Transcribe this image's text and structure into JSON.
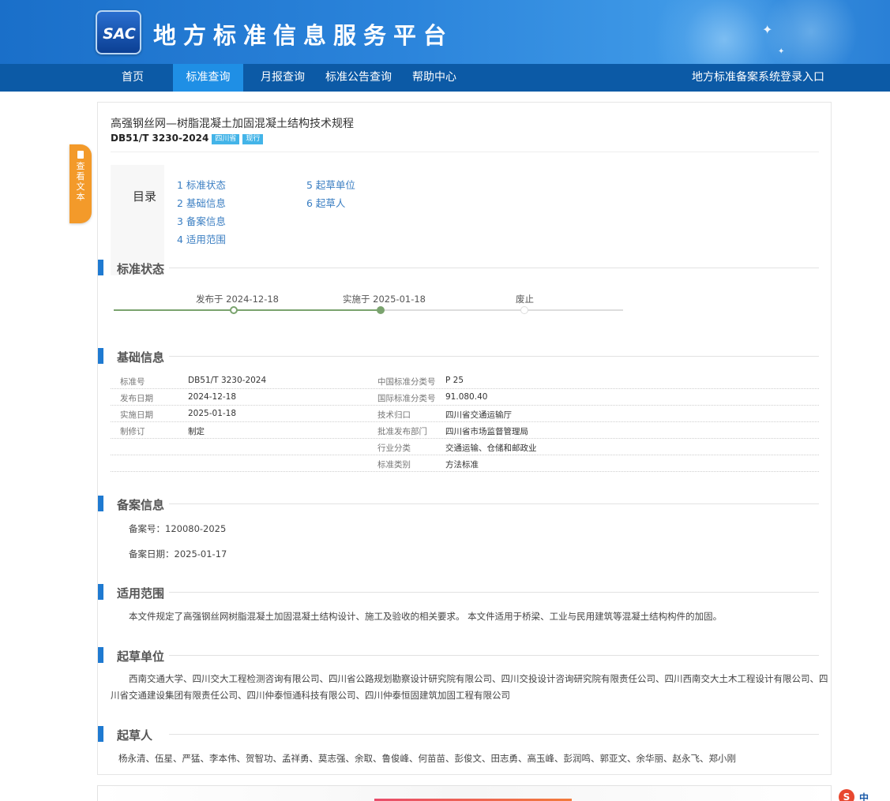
{
  "header": {
    "logo_text": "SAC",
    "site_title": "地方标准信息服务平台"
  },
  "nav": {
    "items": [
      {
        "label": "首页",
        "active": false
      },
      {
        "label": "标准查询",
        "active": true
      },
      {
        "label": "月报查询",
        "active": false
      },
      {
        "label": "标准公告查询",
        "active": false
      },
      {
        "label": "帮助中心",
        "active": false
      }
    ],
    "login_entry": "地方标准备案系统登录入口"
  },
  "side_tab": {
    "label": "查看文本",
    "icon": "document-icon"
  },
  "standard": {
    "title": "高强钢丝网—树脂混凝土加固混凝土结构技术规程",
    "code": "DB51/T 3230-2024",
    "badges": [
      "四川省",
      "现行"
    ]
  },
  "toc": {
    "label": "目录",
    "items": [
      "1 标准状态",
      "2 基础信息",
      "3 备案信息",
      "4 适用范围",
      "5 起草单位",
      "6 起草人"
    ]
  },
  "sections": {
    "status": "标准状态",
    "basic": "基础信息",
    "filing": "备案信息",
    "scope": "适用范围",
    "drafting_units": "起草单位",
    "drafters": "起草人"
  },
  "timeline": {
    "published": "发布于 2024-12-18",
    "implemented": "实施于 2025-01-18",
    "abolished": "废止",
    "colors": {
      "done": "#7aa36e",
      "pending": "#dddddd"
    }
  },
  "basic_info": {
    "left": [
      {
        "key": "标准号",
        "value": "DB51/T 3230-2024"
      },
      {
        "key": "发布日期",
        "value": "2024-12-18"
      },
      {
        "key": "实施日期",
        "value": "2025-01-18"
      },
      {
        "key": "制修订",
        "value": "制定"
      }
    ],
    "right": [
      {
        "key": "中国标准分类号",
        "value": "P 25"
      },
      {
        "key": "国际标准分类号",
        "value": "91.080.40"
      },
      {
        "key": "技术归口",
        "value": "四川省交通运输厅"
      },
      {
        "key": "批准发布部门",
        "value": "四川省市场监督管理局"
      },
      {
        "key": "行业分类",
        "value": "交通运输、仓储和邮政业"
      },
      {
        "key": "标准类别",
        "value": "方法标准"
      }
    ]
  },
  "filing": {
    "number": "备案号：120080-2025",
    "date": "备案日期：2025-01-17"
  },
  "scope_text": "本文件规定了高强钢丝网树脂混凝土加固混凝土结构设计、施工及验收的相关要求。 本文件适用于桥梁、工业与民用建筑等混凝土结构构件的加固。",
  "drafting_units_text": "西南交通大学、四川交大工程检测咨询有限公司、四川省公路规划勘察设计研究院有限公司、四川交投设计咨询研究院有限责任公司、四川西南交大土木工程设计有限公司、四川省交通建设集团有限责任公司、四川仲泰恒通科技有限公司、四川仲泰恒固建筑加固工程有限公司",
  "drafters_text": "杨永清、伍星、严猛、李本伟、贺智功、孟祥勇、莫志强、余取、鲁俊峰、何苗苗、彭俊文、田志勇、高玉峰、彭润鸣、郭亚文、余华丽、赵永飞、郑小刚",
  "ime_indicator": "中"
}
